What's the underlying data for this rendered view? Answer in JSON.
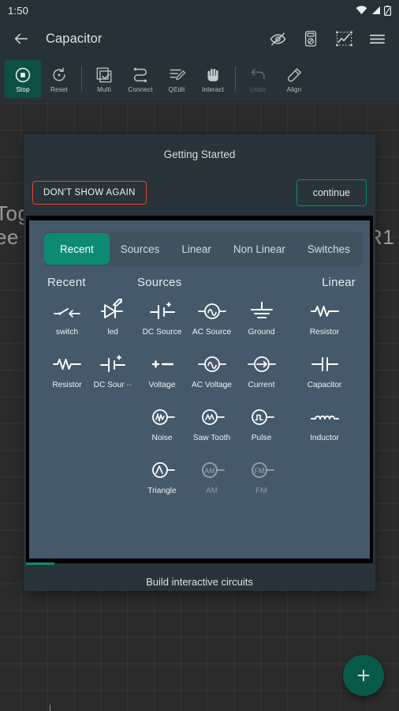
{
  "status_bar": {
    "time": "1:50",
    "icons": [
      "wifi-icon",
      "signal-icon",
      "battery-icon"
    ]
  },
  "app_bar": {
    "back_icon": "back-arrow-icon",
    "title": "Capacitor",
    "actions": [
      {
        "name": "hide-icon",
        "label": "eye-off-icon"
      },
      {
        "name": "multimeter-icon",
        "label": "multimeter-icon"
      },
      {
        "name": "graph-icon",
        "label": "oscilloscope-icon"
      },
      {
        "name": "menu-icon",
        "label": "hamburger-menu-icon"
      }
    ]
  },
  "toolbar": {
    "items": [
      {
        "label": "Stop",
        "icon": "stop-icon",
        "state": "active"
      },
      {
        "label": "Reset",
        "icon": "reset-icon",
        "state": "normal"
      },
      {
        "label": "Multi",
        "icon": "multi-select-icon",
        "state": "normal"
      },
      {
        "label": "Connect",
        "icon": "connect-icon",
        "state": "normal"
      },
      {
        "label": "QEdit",
        "icon": "quick-edit-icon",
        "state": "normal"
      },
      {
        "label": "Interact",
        "icon": "hand-icon",
        "state": "normal"
      },
      {
        "label": "Undo",
        "icon": "undo-icon",
        "state": "disabled"
      },
      {
        "label": "Align",
        "icon": "align-icon",
        "state": "normal"
      }
    ]
  },
  "canvas": {
    "labels": [
      {
        "text": "Tog",
        "name": "canvas-text-tog"
      },
      {
        "text": "ee",
        "name": "canvas-text-ee"
      },
      {
        "text": "R1",
        "name": "canvas-component-label-r1"
      }
    ],
    "fab_icon": "plus-icon"
  },
  "dialog": {
    "title": "Getting Started",
    "dont_show_label": "DON'T SHOW AGAIN",
    "continue_label": "continue",
    "footer_caption": "Build interactive circuits",
    "colors": {
      "dont_show_border": "#e8452c",
      "continue_border": "#0f8a73",
      "accent": "#0c8a72",
      "dialog_bg": "#28333a",
      "media_bg": "#45596a"
    }
  },
  "media": {
    "tabs": [
      {
        "label": "Recent",
        "active": true
      },
      {
        "label": "Sources",
        "active": false
      },
      {
        "label": "Linear",
        "active": false
      },
      {
        "label": "Non Linear",
        "active": false
      },
      {
        "label": "Switches",
        "active": false
      }
    ],
    "columns": [
      {
        "heading": "Recent",
        "items": [
          {
            "label": "switch",
            "icon": "switch-symbol-icon",
            "dim": false
          },
          {
            "label": "led",
            "icon": "led-symbol-icon",
            "dim": false
          },
          {
            "label": "Resistor",
            "icon": "resistor-symbol-icon",
            "dim": false
          },
          {
            "label": "DC Sour ··",
            "icon": "dc-source-symbol-icon",
            "dim": false
          }
        ]
      },
      {
        "heading": "Sources",
        "items": [
          {
            "label": "DC Source",
            "icon": "dc-source-symbol-icon",
            "dim": false
          },
          {
            "label": "AC Source",
            "icon": "ac-source-symbol-icon",
            "dim": false
          },
          {
            "label": "Ground",
            "icon": "ground-symbol-icon",
            "dim": false
          },
          {
            "label": "Voltage",
            "icon": "voltage-symbol-icon",
            "dim": false
          },
          {
            "label": "AC Voltage",
            "icon": "ac-voltage-symbol-icon",
            "dim": false
          },
          {
            "label": "Current",
            "icon": "current-symbol-icon",
            "dim": false
          },
          {
            "label": "Noise",
            "icon": "noise-symbol-icon",
            "dim": false
          },
          {
            "label": "Saw Tooth",
            "icon": "sawtooth-symbol-icon",
            "dim": false
          },
          {
            "label": "Pulse",
            "icon": "pulse-symbol-icon",
            "dim": false
          },
          {
            "label": "Triangle",
            "icon": "triangle-symbol-icon",
            "dim": false
          },
          {
            "label": "AM",
            "icon": "am-symbol-icon",
            "dim": true
          },
          {
            "label": "FM",
            "icon": "fm-symbol-icon",
            "dim": true
          }
        ]
      },
      {
        "heading": "Linear",
        "items": [
          {
            "label": "Resistor",
            "icon": "resistor-symbol-icon",
            "dim": false
          },
          {
            "label": "Capacitor",
            "icon": "capacitor-symbol-icon",
            "dim": false
          },
          {
            "label": "Inductor",
            "icon": "inductor-symbol-icon",
            "dim": false
          }
        ]
      }
    ]
  }
}
